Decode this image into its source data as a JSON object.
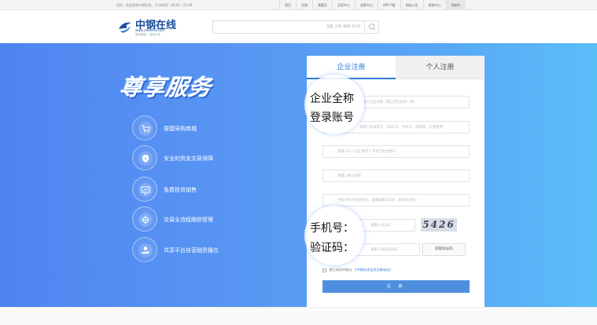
{
  "topbar": {
    "greeting": "您好，欢迎来到中钢在线。  开市时间：09:00 - 21:00",
    "nav": [
      "首页",
      "注册",
      "我要买",
      "买家中心",
      "卖家中心",
      "APP下载",
      "网站公告",
      "帮助中心",
      "购物车"
    ]
  },
  "header": {
    "logo_name": "中钢在线",
    "logo_url": "www.csesteel.com",
    "logo_slogan": "服务钢铁 · 诚信为本",
    "search_placeholder": "热轧  冷轧  镀锌  DC01"
  },
  "hero": {
    "title": "尊享服务",
    "features": [
      "便捷采购商城",
      "安全的资金交易保障",
      "免费挂货销售",
      "交易全流程跟踪管理",
      "共享平台自营融资撮合"
    ]
  },
  "form": {
    "tabs": [
      "企业注册",
      "个人注册"
    ],
    "fields": [
      "请输入企业名称（需与营业执照一致）",
      "请输入登录账号，如QQ号、手机号、邮箱等，方便使用！",
      "请输入6~12位“数字＋字母”组合密码！",
      "请输入确认密码",
      "手机号用于找回密码，请确保真实有效，接收验证码！",
      "请输入验证码",
      "请输入短信验证码"
    ],
    "captcha_text": "5426",
    "sms_button": "获取验证码",
    "agree_text": "我已阅读并确认",
    "agree_link": "《中钢在线会员注册协议》",
    "submit": "注 册"
  },
  "magnifiers": {
    "top": [
      "企业全称",
      "登录账号"
    ],
    "bottom": [
      "手机号：",
      "验证码："
    ]
  },
  "colors": {
    "accent": "#2e7ad8",
    "banner_left": "#4f84f0",
    "banner_right": "#5bbef9"
  }
}
